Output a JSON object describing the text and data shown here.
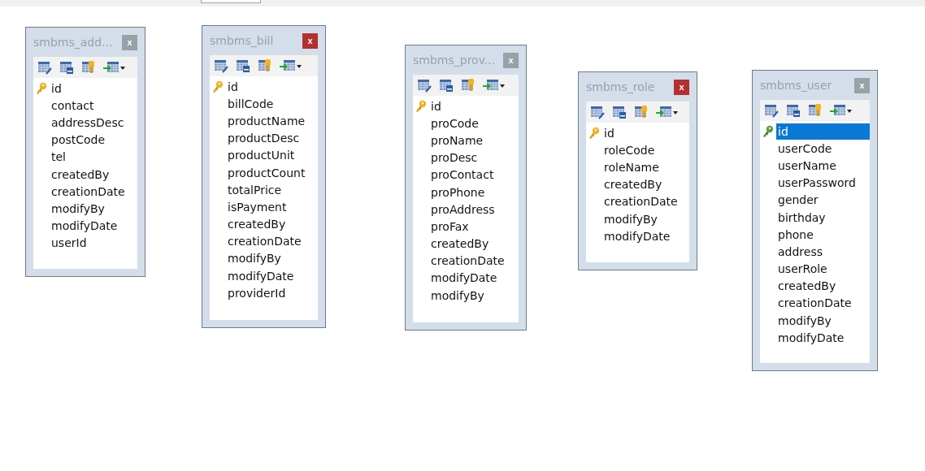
{
  "tables": [
    {
      "title": "smbms_add...",
      "close_label": "x",
      "close_active": false,
      "fields": [
        {
          "name": "id",
          "primary_key": true,
          "selected": false
        },
        {
          "name": "contact",
          "primary_key": false,
          "selected": false
        },
        {
          "name": "addressDesc",
          "primary_key": false,
          "selected": false
        },
        {
          "name": "postCode",
          "primary_key": false,
          "selected": false
        },
        {
          "name": "tel",
          "primary_key": false,
          "selected": false
        },
        {
          "name": "createdBy",
          "primary_key": false,
          "selected": false
        },
        {
          "name": "creationDate",
          "primary_key": false,
          "selected": false
        },
        {
          "name": "modifyBy",
          "primary_key": false,
          "selected": false
        },
        {
          "name": "modifyDate",
          "primary_key": false,
          "selected": false
        },
        {
          "name": "userId",
          "primary_key": false,
          "selected": false
        }
      ]
    },
    {
      "title": "smbms_bill",
      "close_label": "x",
      "close_active": true,
      "fields": [
        {
          "name": "id",
          "primary_key": true,
          "selected": false
        },
        {
          "name": "billCode",
          "primary_key": false,
          "selected": false
        },
        {
          "name": "productName",
          "primary_key": false,
          "selected": false
        },
        {
          "name": "productDesc",
          "primary_key": false,
          "selected": false
        },
        {
          "name": "productUnit",
          "primary_key": false,
          "selected": false
        },
        {
          "name": "productCount",
          "primary_key": false,
          "selected": false
        },
        {
          "name": "totalPrice",
          "primary_key": false,
          "selected": false
        },
        {
          "name": "isPayment",
          "primary_key": false,
          "selected": false
        },
        {
          "name": "createdBy",
          "primary_key": false,
          "selected": false
        },
        {
          "name": "creationDate",
          "primary_key": false,
          "selected": false
        },
        {
          "name": "modifyBy",
          "primary_key": false,
          "selected": false
        },
        {
          "name": "modifyDate",
          "primary_key": false,
          "selected": false
        },
        {
          "name": "providerId",
          "primary_key": false,
          "selected": false
        }
      ]
    },
    {
      "title": "smbms_prov...",
      "close_label": "x",
      "close_active": false,
      "fields": [
        {
          "name": "id",
          "primary_key": true,
          "selected": false
        },
        {
          "name": "proCode",
          "primary_key": false,
          "selected": false
        },
        {
          "name": "proName",
          "primary_key": false,
          "selected": false
        },
        {
          "name": "proDesc",
          "primary_key": false,
          "selected": false
        },
        {
          "name": "proContact",
          "primary_key": false,
          "selected": false
        },
        {
          "name": "proPhone",
          "primary_key": false,
          "selected": false
        },
        {
          "name": "proAddress",
          "primary_key": false,
          "selected": false
        },
        {
          "name": "proFax",
          "primary_key": false,
          "selected": false
        },
        {
          "name": "createdBy",
          "primary_key": false,
          "selected": false
        },
        {
          "name": "creationDate",
          "primary_key": false,
          "selected": false
        },
        {
          "name": "modifyDate",
          "primary_key": false,
          "selected": false
        },
        {
          "name": "modifyBy",
          "primary_key": false,
          "selected": false
        }
      ]
    },
    {
      "title": "smbms_role",
      "close_label": "x",
      "close_active": true,
      "fields": [
        {
          "name": "id",
          "primary_key": true,
          "selected": false
        },
        {
          "name": "roleCode",
          "primary_key": false,
          "selected": false
        },
        {
          "name": "roleName",
          "primary_key": false,
          "selected": false
        },
        {
          "name": "createdBy",
          "primary_key": false,
          "selected": false
        },
        {
          "name": "creationDate",
          "primary_key": false,
          "selected": false
        },
        {
          "name": "modifyBy",
          "primary_key": false,
          "selected": false
        },
        {
          "name": "modifyDate",
          "primary_key": false,
          "selected": false
        }
      ]
    },
    {
      "title": "smbms_user",
      "close_label": "x",
      "close_active": false,
      "fields": [
        {
          "name": "id",
          "primary_key": true,
          "selected": true
        },
        {
          "name": "userCode",
          "primary_key": false,
          "selected": false
        },
        {
          "name": "userName",
          "primary_key": false,
          "selected": false
        },
        {
          "name": "userPassword",
          "primary_key": false,
          "selected": false
        },
        {
          "name": "gender",
          "primary_key": false,
          "selected": false
        },
        {
          "name": "birthday",
          "primary_key": false,
          "selected": false
        },
        {
          "name": "phone",
          "primary_key": false,
          "selected": false
        },
        {
          "name": "address",
          "primary_key": false,
          "selected": false
        },
        {
          "name": "userRole",
          "primary_key": false,
          "selected": false
        },
        {
          "name": "createdBy",
          "primary_key": false,
          "selected": false
        },
        {
          "name": "creationDate",
          "primary_key": false,
          "selected": false
        },
        {
          "name": "modifyBy",
          "primary_key": false,
          "selected": false
        },
        {
          "name": "modifyDate",
          "primary_key": false,
          "selected": false
        }
      ]
    }
  ]
}
